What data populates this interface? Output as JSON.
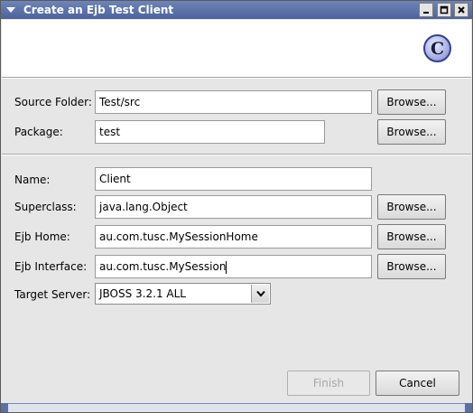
{
  "window": {
    "title": "Create an Ejb Test Client"
  },
  "form": {
    "source_folder": {
      "label": "Source Folder:",
      "value": "Test/src",
      "browse": "Browse..."
    },
    "package": {
      "label": "Package:",
      "value": "test",
      "browse": "Browse..."
    },
    "name": {
      "label": "Name:",
      "value": "Client"
    },
    "superclass": {
      "label": "Superclass:",
      "value": "java.lang.Object",
      "browse": "Browse..."
    },
    "ejb_home": {
      "label": "Ejb Home:",
      "value": "au.com.tusc.MySessionHome",
      "browse": "Browse..."
    },
    "ejb_interface": {
      "label": "Ejb Interface:",
      "value": "au.com.tusc.MySession",
      "browse": "Browse..."
    },
    "target_server": {
      "label": "Target Server:",
      "selected": "JBOSS 3.2.1 ALL"
    }
  },
  "buttons": {
    "finish": "Finish",
    "cancel": "Cancel"
  },
  "icons": {
    "window_menu": "down-arrow-icon",
    "minimize": "minimize-icon",
    "maximize": "maximize-icon",
    "close": "close-icon",
    "banner": "class-c-icon",
    "combo": "chevron-down-icon"
  },
  "banner_icon_letter": "C",
  "colors": {
    "titlebar": "#5a6fa8",
    "dialog_bg": "#e6e6e6",
    "banner_bg": "#ffffff"
  }
}
